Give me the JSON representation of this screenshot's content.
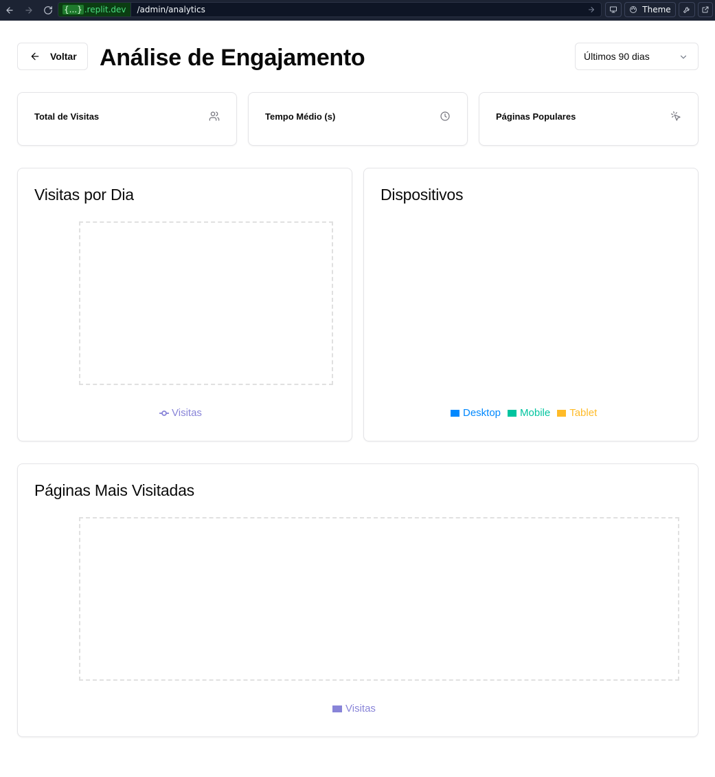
{
  "browser": {
    "domain_badge": "{...}",
    "domain_suffix": ".replit.dev",
    "path": "/admin/analytics",
    "theme_label": "Theme"
  },
  "header": {
    "back_label": "Voltar",
    "title": "Análise de Engajamento",
    "range_selected": "Últimos 90 dias"
  },
  "stats": [
    {
      "title": "Total de Visitas",
      "icon": "users-icon"
    },
    {
      "title": "Tempo Médio (s)",
      "icon": "clock-icon"
    },
    {
      "title": "Páginas Populares",
      "icon": "pointer-click-icon"
    }
  ],
  "charts": {
    "visits_per_day": {
      "title": "Visitas por Dia",
      "legend": "Visitas",
      "color": "#8884d8"
    },
    "devices": {
      "title": "Dispositivos",
      "legend": [
        {
          "label": "Desktop",
          "color": "#0088fe"
        },
        {
          "label": "Mobile",
          "color": "#00c49f"
        },
        {
          "label": "Tablet",
          "color": "#ffbb28"
        }
      ]
    },
    "top_pages": {
      "title": "Páginas Mais Visitadas",
      "legend": "Visitas",
      "color": "#8884d8"
    }
  }
}
